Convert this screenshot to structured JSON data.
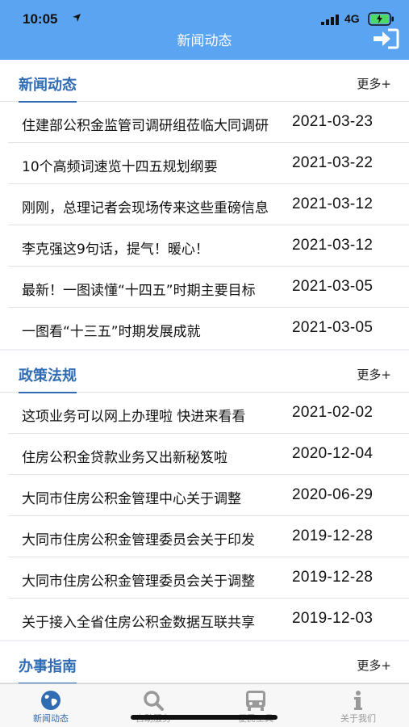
{
  "status": {
    "time": "10:05",
    "network": "4G"
  },
  "header": {
    "title": "新闻动态"
  },
  "sections": [
    {
      "title": "新闻动态",
      "more": "更多+",
      "items": [
        {
          "title": "住建部公积金监管司调研组莅临大同调研",
          "date": "2021-03-23"
        },
        {
          "title": "10个高频词速览十四五规划纲要",
          "date": "2021-03-22"
        },
        {
          "title": "刚刚，总理记者会现场传来这些重磅信息",
          "date": "2021-03-12"
        },
        {
          "title": "李克强这9句话，提气！暖心！",
          "date": "2021-03-12"
        },
        {
          "title": "最新！一图读懂“十四五”时期主要目标",
          "date": "2021-03-05"
        },
        {
          "title": "一图看“十三五”时期发展成就",
          "date": "2021-03-05"
        }
      ]
    },
    {
      "title": "政策法规",
      "more": "更多+",
      "items": [
        {
          "title": "这项业务可以网上办理啦 快进来看看",
          "date": "2021-02-02"
        },
        {
          "title": "住房公积金贷款业务又出新秘笈啦",
          "date": "2020-12-04"
        },
        {
          "title": "大同市住房公积金管理中心关于调整",
          "date": "2020-06-29"
        },
        {
          "title": "大同市住房公积金管理委员会关于印发",
          "date": "2019-12-28"
        },
        {
          "title": "大同市住房公积金管理委员会关于调整",
          "date": "2019-12-28"
        },
        {
          "title": "关于接入全省住房公积金数据互联共享",
          "date": "2019-12-03"
        }
      ]
    },
    {
      "title": "办事指南",
      "more": "更多+",
      "items": []
    }
  ],
  "tabs": [
    {
      "label": "新闻动态",
      "icon": "globe-icon",
      "active": true
    },
    {
      "label": "自助服务",
      "icon": "search-icon",
      "active": false
    },
    {
      "label": "便民工具",
      "icon": "bus-icon",
      "active": false
    },
    {
      "label": "关于我们",
      "icon": "info-icon",
      "active": false
    }
  ],
  "colors": {
    "header": "#5ba4f2",
    "accent": "#2f6cb3",
    "inactive": "#999999"
  }
}
